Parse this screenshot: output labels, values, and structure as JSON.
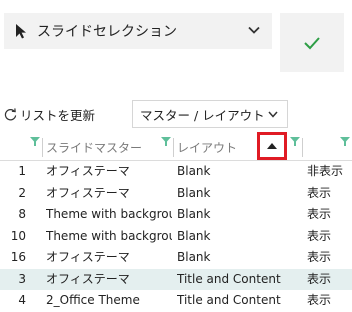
{
  "slide_selector": {
    "label": "スライドセレクション"
  },
  "confirm_button": {
    "icon": "checkmark-icon",
    "color": "#2e9e46"
  },
  "toolbar": {
    "refresh_label": "リストを更新",
    "mode_value": "マスター / レイアウト"
  },
  "table": {
    "headers": {
      "master": "スライドマスター",
      "layout": "レイアウト"
    },
    "rows": [
      {
        "num": "1",
        "master": "オフィステーマ",
        "layout": "Blank",
        "visibility": "非表示"
      },
      {
        "num": "2",
        "master": "オフィステーマ",
        "layout": "Blank",
        "visibility": "表示"
      },
      {
        "num": "8",
        "master": "Theme with backgrou...",
        "layout": "Blank",
        "visibility": "表示"
      },
      {
        "num": "10",
        "master": "Theme with backgrou...",
        "layout": "Blank",
        "visibility": "表示"
      },
      {
        "num": "16",
        "master": "オフィステーマ",
        "layout": "Blank",
        "visibility": "表示"
      },
      {
        "num": "3",
        "master": "オフィステーマ",
        "layout": "Title and Content",
        "visibility": "表示",
        "selected": true
      },
      {
        "num": "4",
        "master": "2_Office Theme",
        "layout": "Title and Content",
        "visibility": "表示"
      }
    ]
  },
  "colors": {
    "filter_icon": "#5fbf9a",
    "highlight_border": "#e01b24",
    "selected_row": "#e4efef"
  }
}
